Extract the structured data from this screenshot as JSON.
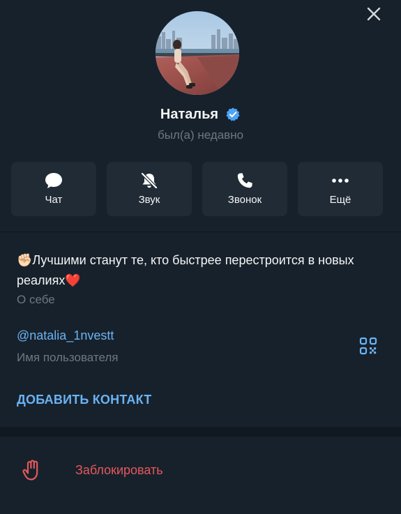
{
  "profile": {
    "name": "Наталья",
    "status": "был(а) недавно",
    "verified": true
  },
  "actions": [
    {
      "label": "Чат",
      "icon": "chat-bubble-icon"
    },
    {
      "label": "Звук",
      "icon": "bell-muted-icon"
    },
    {
      "label": "Звонок",
      "icon": "phone-icon"
    },
    {
      "label": "Ещё",
      "icon": "more-dots-icon"
    }
  ],
  "info": {
    "bio_emoji": "✊🏻",
    "bio_text": "Лучшими станут те, кто быстрее перестроится в новых реалиях",
    "bio_emoji_end": "❤️",
    "bio_caption": "О себе",
    "username": "@natalia_1nvestt",
    "username_caption": "Имя пользователя",
    "add_contact": "ДОБАВИТЬ КОНТАКТ"
  },
  "block": {
    "label": "Заблокировать",
    "icon": "hand-stop-icon"
  },
  "colors": {
    "background": "#17212b",
    "card": "#202b36",
    "accent": "#6ab3f3",
    "muted": "#6d7883",
    "danger": "#e5585d",
    "verified": "#4ea4f6"
  }
}
